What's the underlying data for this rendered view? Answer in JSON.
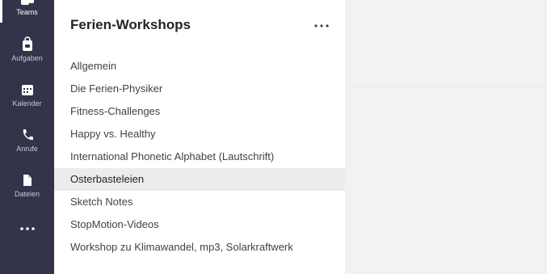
{
  "rail": {
    "items": [
      {
        "label": "Teams",
        "icon": "teams-icon",
        "active": true
      },
      {
        "label": "Aufgaben",
        "icon": "assignments-icon",
        "active": false
      },
      {
        "label": "Kalender",
        "icon": "calendar-icon",
        "active": false
      },
      {
        "label": "Anrufe",
        "icon": "phone-icon",
        "active": false
      },
      {
        "label": "Dateien",
        "icon": "files-icon",
        "active": false
      }
    ],
    "more_icon": "ellipsis-icon"
  },
  "team": {
    "name": "Ferien-Workshops",
    "more_icon": "ellipsis-icon"
  },
  "channels": [
    "Allgemein",
    "Die Ferien-Physiker",
    "Fitness-Challenges",
    "Happy vs. Healthy",
    "International Phonetic Alphabet (Lautschrift)",
    "Osterbasteleien",
    "Sketch Notes",
    "StopMotion-Videos",
    "Workshop zu Klimawandel, mp3, Solarkraftwerk"
  ],
  "selected_channel": "Osterbasteleien",
  "colors": {
    "rail_bg": "#33344a",
    "selected_bg": "#ececec",
    "content_bg": "#f3f2f1"
  }
}
